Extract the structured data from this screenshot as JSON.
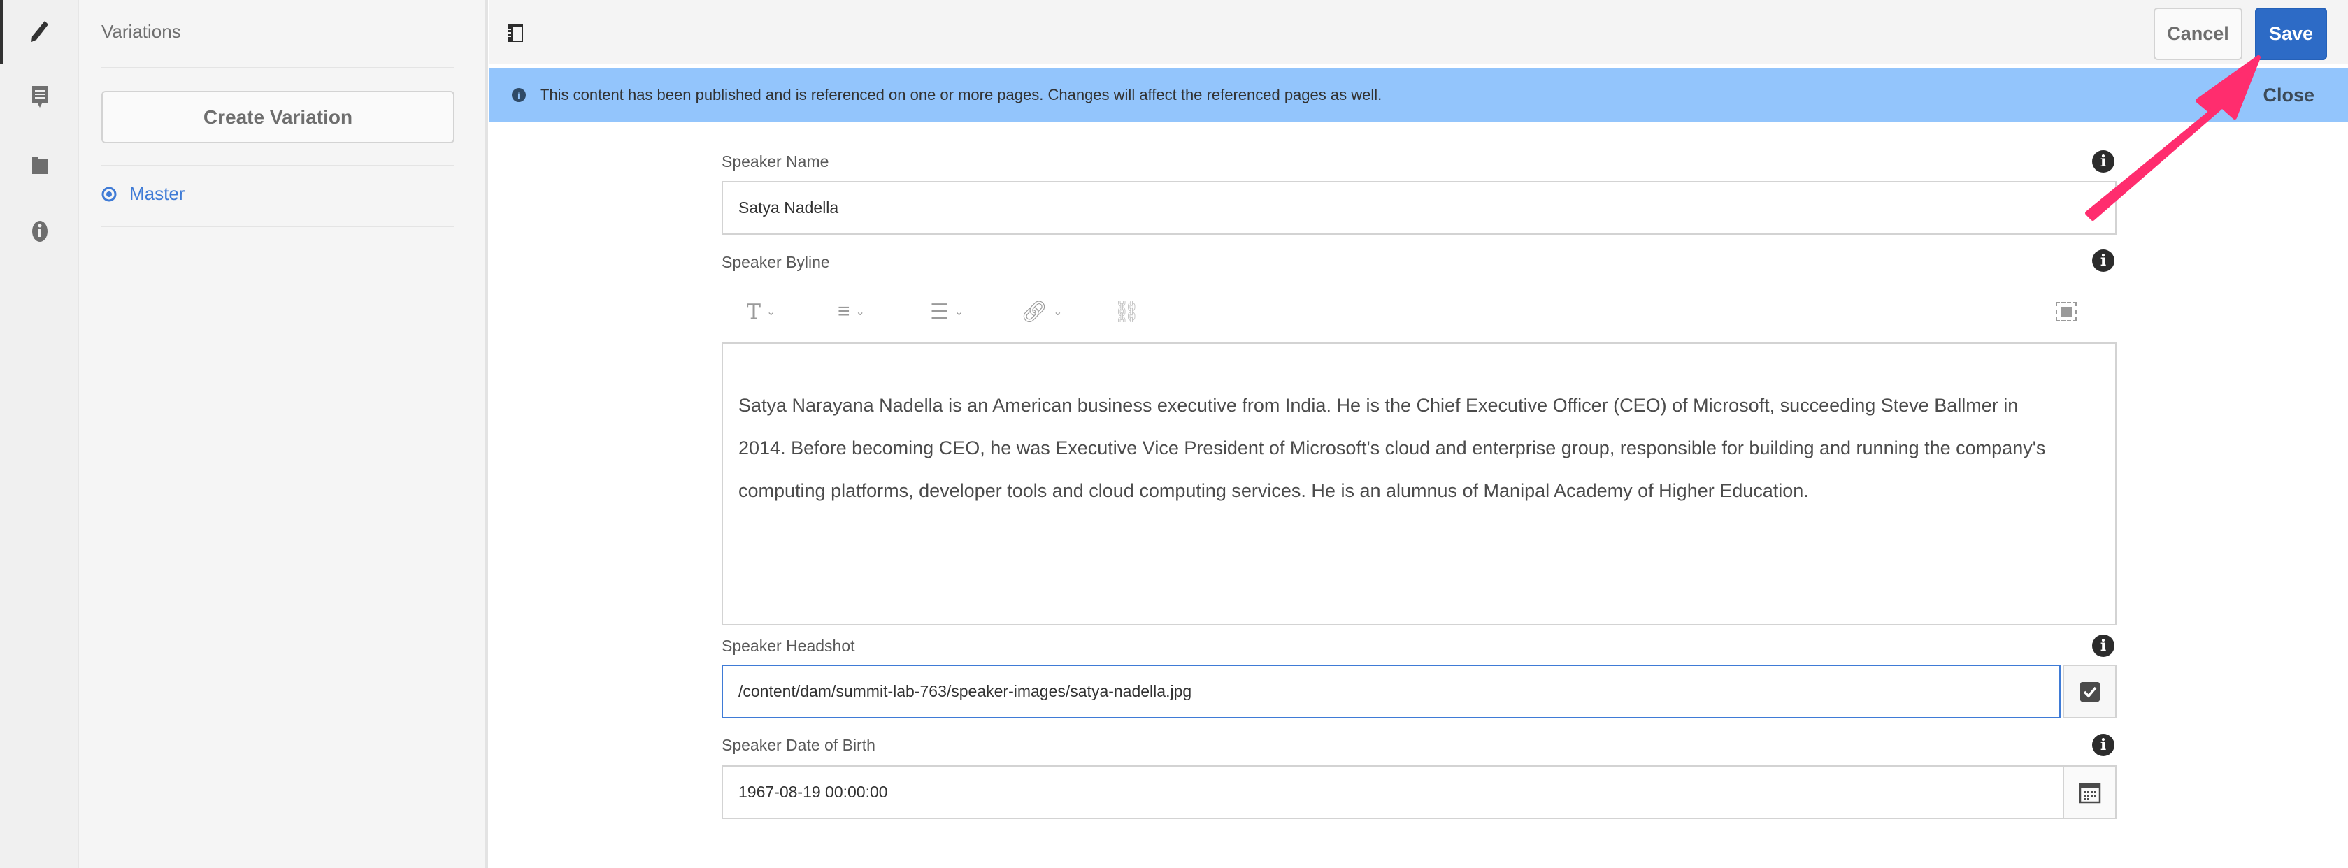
{
  "rail": {
    "items": [
      {
        "icon": "pencil-icon"
      },
      {
        "icon": "comment-icon"
      },
      {
        "icon": "folder-icon"
      },
      {
        "icon": "info-icon"
      }
    ]
  },
  "panel": {
    "title": "Variations",
    "create_label": "Create Variation",
    "variations": [
      {
        "label": "Master",
        "icon": "eye-icon"
      }
    ]
  },
  "toolbar": {
    "cancel_label": "Cancel",
    "save_label": "Save"
  },
  "banner": {
    "message": "This content has been published and is referenced on one or more pages. Changes will affect the referenced pages as well.",
    "close_label": "Close"
  },
  "form": {
    "speaker_name": {
      "label": "Speaker Name",
      "value": "Satya Nadella"
    },
    "speaker_byline": {
      "label": "Speaker Byline",
      "lines": [
        "Satya Narayana Nadella is an American business executive from India. He is the Chief Executive Officer (CEO) of Microsoft, succeeding Steve Ballmer in",
        "2014. Before becoming CEO, he was Executive Vice President of Microsoft's cloud and enterprise group, responsible for building and running the company's",
        "computing platforms, developer tools and cloud computing services. He is an alumnus of Manipal Academy of Higher Education."
      ]
    },
    "speaker_headshot": {
      "label": "Speaker Headshot",
      "value": "/content/dam/summit-lab-763/speaker-images/satya-nadella.jpg"
    },
    "speaker_dob": {
      "label": "Speaker Date of Birth",
      "value": "1967-08-19 00:00:00"
    }
  },
  "colors": {
    "accent": "#2d6bc6",
    "banner": "#93c5fc",
    "annotation_arrow": "#ff2d6e",
    "link": "#3f7bd6"
  }
}
